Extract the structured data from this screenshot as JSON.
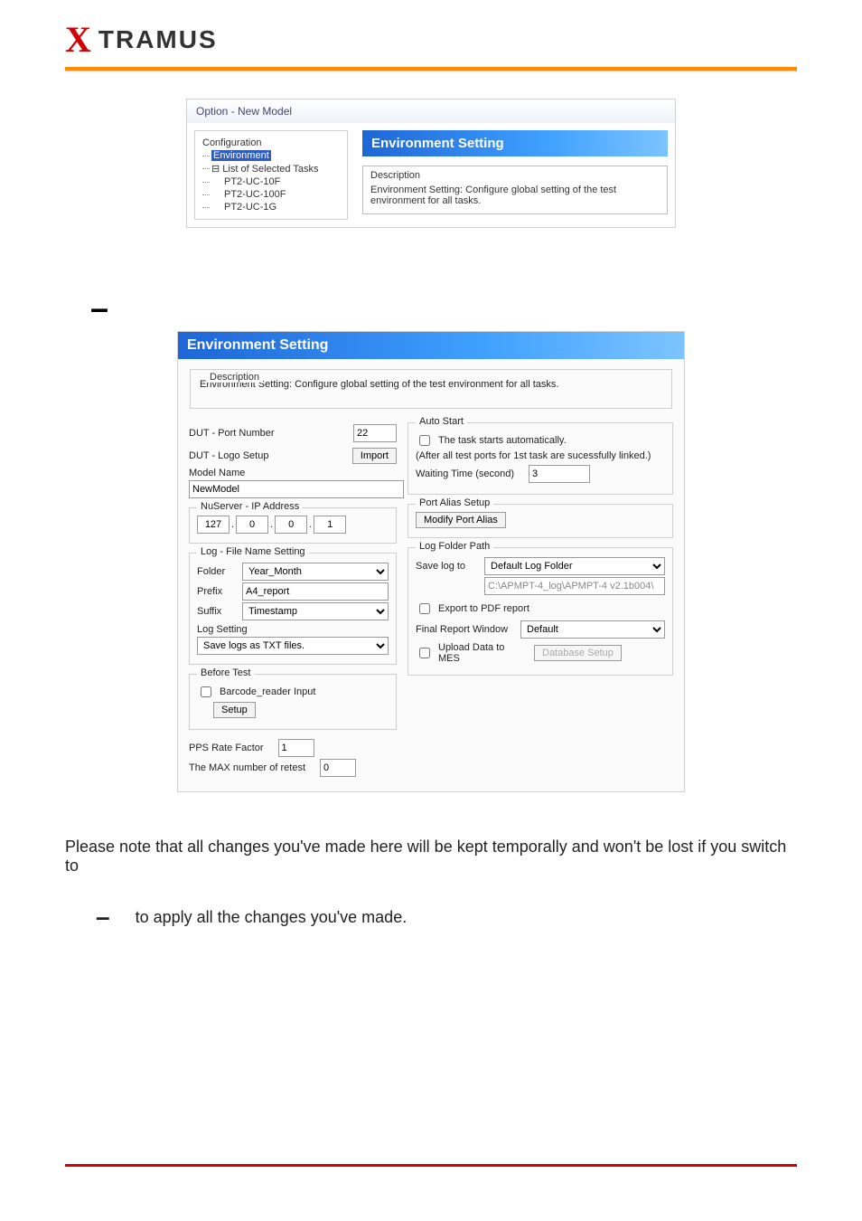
{
  "logo": {
    "x": "X",
    "rest": "TRAMUS"
  },
  "panel1": {
    "title": "Option - New Model",
    "tree": {
      "root": "Configuration",
      "env_selected": "Environment",
      "list_label": "List of Selected Tasks",
      "items": [
        "PT2-UC-10F",
        "PT2-UC-100F",
        "PT2-UC-1G"
      ]
    },
    "heading": "Environment Setting",
    "desc_label": "Description",
    "desc_text": "Environment Setting: Configure global setting of the test environment for all tasks."
  },
  "dash": "–",
  "panel2": {
    "heading": "Environment Setting",
    "desc_label": "Description",
    "desc_text": "Environment Setting: Configure global setting of the test environment for all tasks.",
    "left": {
      "dut_port_label": "DUT - Port Number",
      "dut_port_value": "22",
      "logo_label": "DUT - Logo Setup",
      "import_btn": "Import",
      "model_name_label": "Model Name",
      "model_name_value": "NewModel",
      "nuserver_label": "NuServer - IP Address",
      "ip": [
        "127",
        "0",
        "0",
        "1"
      ],
      "log_group_label": "Log - File Name Setting",
      "folder_label": "Folder",
      "folder_sel": "Year_Month",
      "prefix_label": "Prefix",
      "prefix_value": "A4_report",
      "suffix_label": "Suffix",
      "suffix_sel": "Timestamp",
      "logsetting_label": "Log Setting",
      "logsetting_sel": "Save logs as TXT files.",
      "before_group_label": "Before Test",
      "barcode_cb_label": "Barcode_reader Input",
      "setup_btn": "Setup",
      "pps_label": "PPS Rate Factor",
      "pps_value": "1",
      "retest_label": "The MAX number of retest",
      "retest_value": "0"
    },
    "right": {
      "auto_group_label": "Auto Start",
      "auto_cb_label": "The task starts automatically.",
      "auto_hint": "(After all test ports for 1st task are sucessfully linked.)",
      "waiting_label": "Waiting Time (second)",
      "waiting_value": "3",
      "port_group_label": "Port Alias Setup",
      "modify_btn": "Modify Port Alias",
      "log_group_label": "Log Folder Path",
      "savelog_label": "Save log to",
      "savelog_sel": "Default Log Folder",
      "savelog_path": "C:\\APMPT-4_log\\APMPT-4 v2.1b004\\",
      "export_cb_label": "Export to PDF report",
      "final_label": "Final Report Window",
      "final_sel": "Default",
      "upload_cb_label": "Upload Data to MES",
      "db_btn": "Database Setup"
    }
  },
  "body_text": {
    "line1": "Please note that all changes you've made here will be kept temporally and won't be lost if you switch to",
    "dash": "–",
    "line2": "to apply all the changes you've made."
  }
}
